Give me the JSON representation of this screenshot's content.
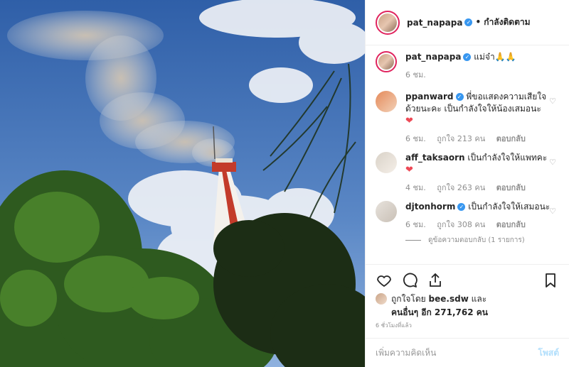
{
  "post": {
    "author": "pat_napapa",
    "follow_status": "• กำลังติดตาม",
    "caption": "แม่จ๋า🙏🙏",
    "caption_time": "6 ชม."
  },
  "comments": [
    {
      "user": "ppanward",
      "text": "พี่ขอแสดงความเสียใจด้วยนะคะ เป็นกำลังใจให้น้องเสมอนะ",
      "emoji": "❤",
      "time": "6 ชม.",
      "likes": "ถูกใจ 213 คน",
      "reply": "ตอบกลับ"
    },
    {
      "user": "aff_taksaorn",
      "text": "เป็นกำลังใจให้แพทคะ",
      "emoji": "❤",
      "time": "4 ชม.",
      "likes": "ถูกใจ 263 คน",
      "reply": "ตอบกลับ"
    },
    {
      "user": "djtonhorm",
      "text": "เป็นกำลังใจให้เสมอนะ",
      "emoji": "",
      "time": "6 ชม.",
      "likes": "ถูกใจ 308 คน",
      "reply": "ตอบกลับ",
      "view_replies": "ดูข้อความตอบกลับ (1 รายการ)"
    }
  ],
  "likes": {
    "line1": "ถูกใจโดย",
    "liked_by": "bee.sdw",
    "and": "และ",
    "line2": "คนอื่นๆ อีก 271,762 คน"
  },
  "timeago": "6 ชั่วโมงที่แล้ว",
  "add_comment": {
    "placeholder": "เพิ่มความคิดเห็น",
    "post": "โพสต์"
  },
  "colors": {
    "verified": "#3897f0",
    "link": "#b2dffc",
    "heart": "#ed4956"
  }
}
